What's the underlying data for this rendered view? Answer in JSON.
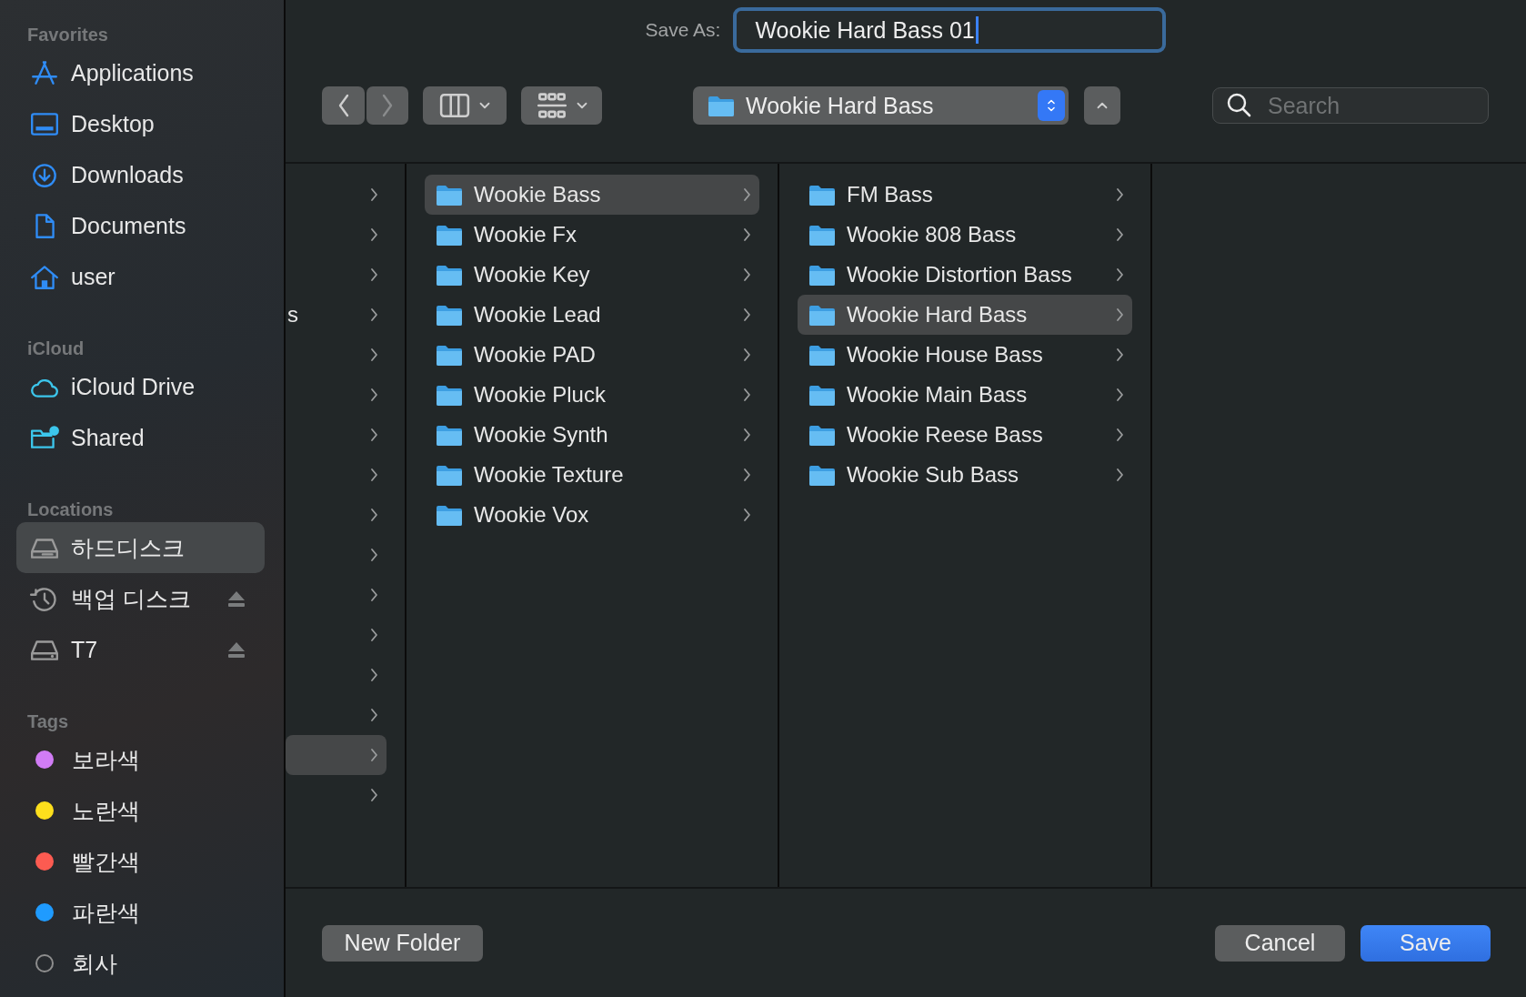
{
  "save_as": {
    "label": "Save As:",
    "value": "Wookie Hard Bass 01",
    "focused": true
  },
  "toolbar": {
    "path": "Wookie Hard Bass",
    "search": {
      "placeholder": "Search"
    }
  },
  "sidebar": {
    "sections": [
      {
        "title": "Favorites",
        "items": [
          {
            "label": "Applications",
            "selected": false
          },
          {
            "label": "Desktop",
            "selected": false
          },
          {
            "label": "Downloads",
            "selected": false
          },
          {
            "label": "Documents",
            "selected": false
          },
          {
            "label": "user",
            "selected": false
          }
        ]
      },
      {
        "title": "iCloud",
        "items": [
          {
            "label": "iCloud Drive",
            "selected": false
          },
          {
            "label": "Shared",
            "selected": false
          }
        ]
      },
      {
        "title": "Locations",
        "items": [
          {
            "label": "하드디스크",
            "selected": true,
            "ejectable": false
          },
          {
            "label": "백업 디스크",
            "selected": false,
            "ejectable": true
          },
          {
            "label": "T7",
            "selected": false,
            "ejectable": true
          }
        ]
      },
      {
        "title": "Tags",
        "items": [
          {
            "label": "보라색",
            "selected": false,
            "kind": "dot",
            "color": "#d17cf5"
          },
          {
            "label": "노란색",
            "selected": false,
            "kind": "dot",
            "color": "#fddf1c"
          },
          {
            "label": "빨간색",
            "selected": false,
            "kind": "dot",
            "color": "#fc5b51"
          },
          {
            "label": "파란색",
            "selected": false,
            "kind": "dot",
            "color": "#1f9bff"
          },
          {
            "label": "회사",
            "selected": false,
            "kind": "ring",
            "color": "#8e8e8e"
          }
        ]
      }
    ]
  },
  "columns": [
    {
      "items": [
        {
          "selected": false
        },
        {
          "selected": false
        },
        {
          "selected": false
        },
        {
          "label": "s",
          "selected": false
        },
        {
          "selected": false
        },
        {
          "selected": false
        },
        {
          "selected": false
        },
        {
          "selected": false
        },
        {
          "selected": false
        },
        {
          "selected": false
        },
        {
          "selected": false
        },
        {
          "selected": false
        },
        {
          "selected": false
        },
        {
          "selected": false
        },
        {
          "selected": true
        },
        {
          "selected": false
        }
      ]
    },
    {
      "items": [
        {
          "label": "Wookie Bass",
          "selected": true
        },
        {
          "label": "Wookie Fx",
          "selected": false
        },
        {
          "label": "Wookie Key",
          "selected": false
        },
        {
          "label": "Wookie Lead",
          "selected": false
        },
        {
          "label": "Wookie PAD",
          "selected": false
        },
        {
          "label": "Wookie Pluck",
          "selected": false
        },
        {
          "label": "Wookie Synth",
          "selected": false
        },
        {
          "label": "Wookie Texture",
          "selected": false
        },
        {
          "label": "Wookie Vox",
          "selected": false
        }
      ]
    },
    {
      "items": [
        {
          "label": "FM Bass",
          "selected": false
        },
        {
          "label": "Wookie 808 Bass",
          "selected": false
        },
        {
          "label": "Wookie Distortion Bass",
          "selected": false
        },
        {
          "label": "Wookie Hard Bass",
          "selected": true
        },
        {
          "label": "Wookie House Bass",
          "selected": false
        },
        {
          "label": "Wookie Main Bass",
          "selected": false
        },
        {
          "label": "Wookie Reese Bass",
          "selected": false
        },
        {
          "label": "Wookie Sub Bass",
          "selected": false
        }
      ]
    }
  ],
  "buttons": [
    {
      "label": "New Folder",
      "default": false
    },
    {
      "label": "Cancel",
      "default": false
    },
    {
      "label": "Save",
      "default": true
    }
  ]
}
